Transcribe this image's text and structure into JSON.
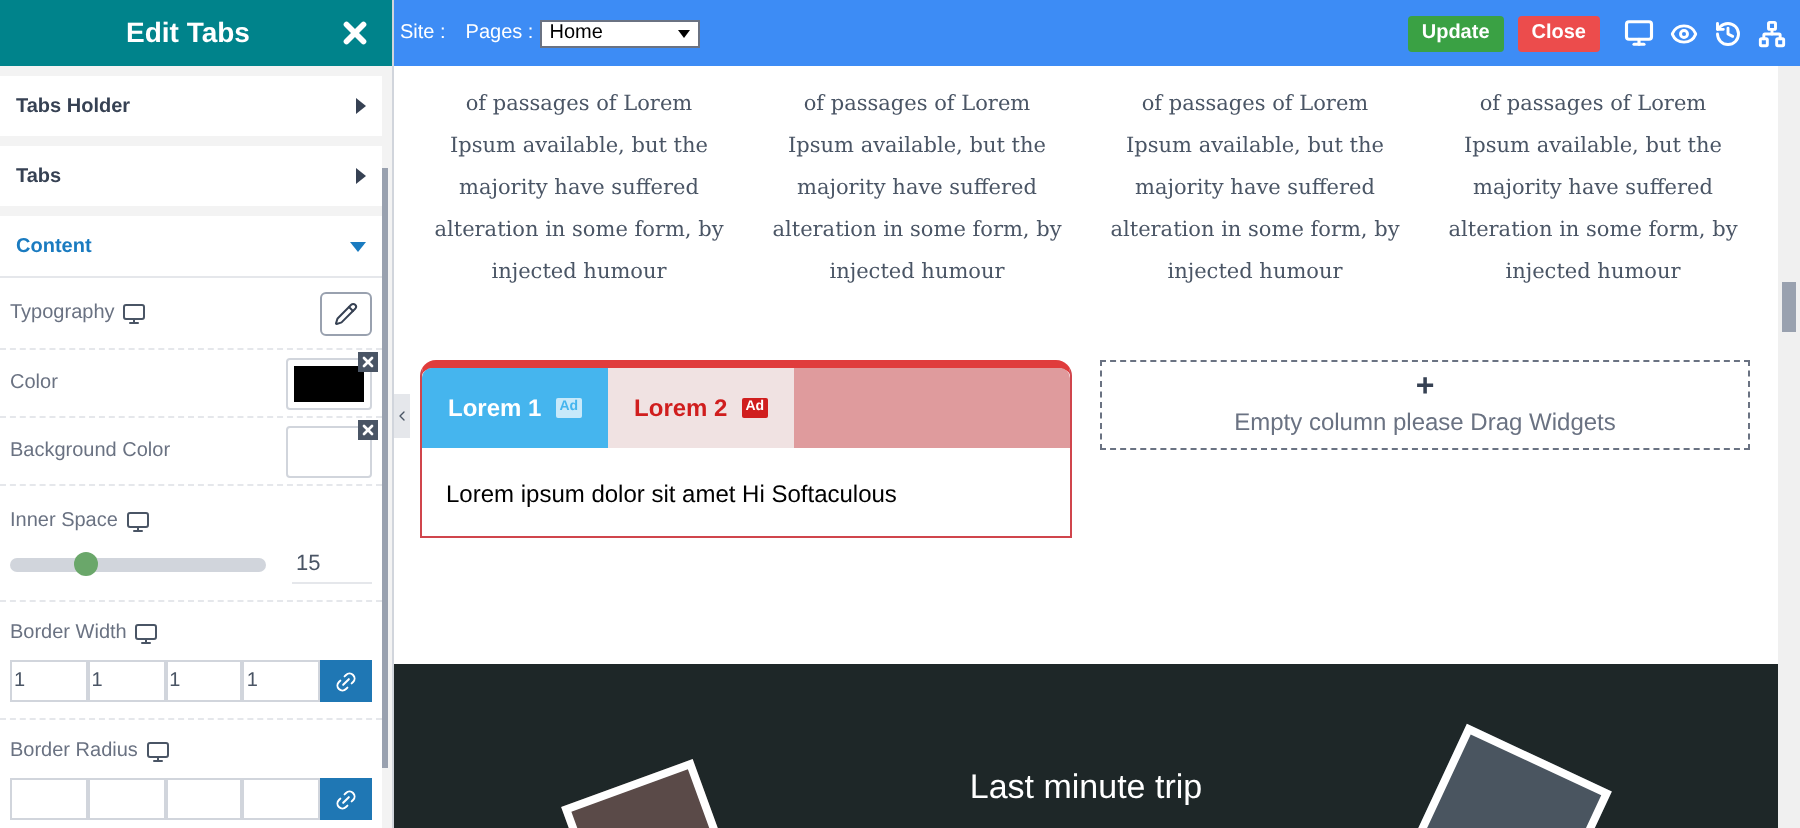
{
  "sidebar": {
    "title": "Edit Tabs",
    "sections": [
      {
        "label": "Tabs Holder",
        "expanded": false
      },
      {
        "label": "Tabs",
        "expanded": false
      },
      {
        "label": "Content",
        "expanded": true
      }
    ],
    "properties": [
      {
        "kind": "edit",
        "label": "Typography",
        "responsive": true
      },
      {
        "kind": "color",
        "label": "Color",
        "responsive": false,
        "color": "#000000"
      },
      {
        "kind": "color",
        "label": "Background Color",
        "responsive": false,
        "color": "#ffffff"
      },
      {
        "kind": "slider",
        "label": "Inner Space",
        "responsive": true,
        "level": 0.3,
        "value": "15"
      },
      {
        "kind": "quad",
        "label": "Border Width",
        "responsive": true,
        "values": [
          "1",
          "1",
          "1",
          "1"
        ]
      },
      {
        "kind": "quad",
        "label": "Border Radius",
        "responsive": true
      }
    ]
  },
  "topbar": {
    "site_label": "Site :",
    "pages_label": "Pages :",
    "page_select": "Home",
    "buttons": [
      {
        "label": "Update",
        "kind": "update"
      },
      {
        "label": "Close",
        "kind": "close"
      }
    ]
  },
  "text_columns": [
    {
      "lines": [
        "of passages of Lorem",
        "Ipsum available, but the",
        "majority have suffered",
        "alteration in some form, by",
        "injected humour"
      ]
    },
    {
      "lines": [
        "of passages of Lorem",
        "Ipsum available, but the",
        "majority have suffered",
        "alteration in some form, by",
        "injected humour"
      ]
    },
    {
      "lines": [
        "of passages of Lorem",
        "Ipsum available, but the",
        "majority have suffered",
        "alteration in some form, by",
        "injected humour"
      ]
    },
    {
      "lines": [
        "of passages of Lorem",
        "Ipsum available, but the",
        "majority have suffered",
        "alteration in some form, by",
        "injected humour"
      ]
    }
  ],
  "tabs_widget": {
    "tabs": [
      {
        "label": "Lorem 1",
        "badge": "Ad",
        "selected": true
      },
      {
        "label": "Lorem 2",
        "badge": "Ad",
        "selected": false
      }
    ],
    "body": "Lorem ipsum dolor sit amet Hi Softaculous"
  },
  "empty_column": {
    "icon": "+",
    "text": "Empty column please Drag Widgets"
  },
  "hero": {
    "title": "Last minute trip"
  }
}
